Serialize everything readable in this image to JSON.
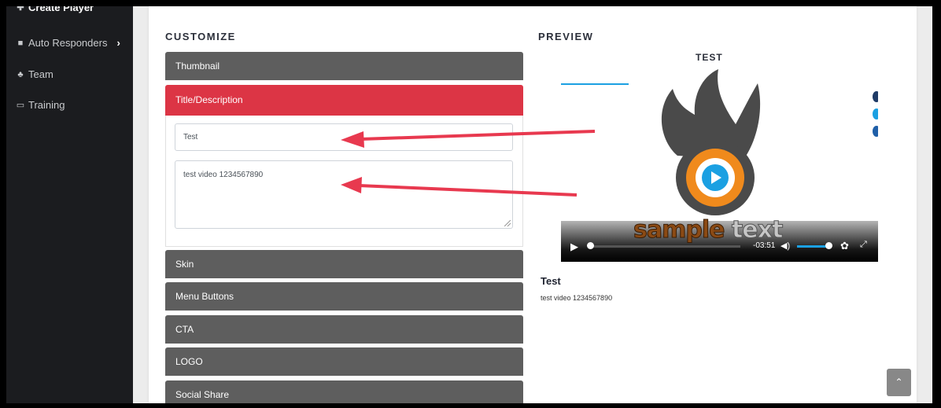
{
  "sidebar": {
    "items": [
      {
        "label": "Create Player",
        "icon": "plus-icon"
      },
      {
        "label": "Auto Responders",
        "icon": "folder-icon"
      },
      {
        "label": "Team",
        "icon": "team-icon"
      },
      {
        "label": "Training",
        "icon": "monitor-icon"
      }
    ]
  },
  "customize": {
    "heading": "CUSTOMIZE",
    "sections": [
      {
        "label": "Thumbnail"
      },
      {
        "label": "Title/Description"
      },
      {
        "label": "Skin"
      },
      {
        "label": "Menu Buttons"
      },
      {
        "label": "CTA"
      },
      {
        "label": "LOGO"
      },
      {
        "label": "Social Share"
      }
    ],
    "title_value": "Test",
    "description_value": "test video 1234567890"
  },
  "preview": {
    "heading": "PREVIEW",
    "video_name": "TEST",
    "overlay_text_1": "sample",
    "overlay_text_2": "text",
    "time_remaining": "-03:51",
    "caption_title": "Test",
    "caption_description": "test video 1234567890"
  },
  "colors": {
    "accent": "#dc3545",
    "accordion": "#5e5e5e",
    "sidebar": "#1b1c1f",
    "play_orange": "#f08a1c",
    "play_blue": "#1ba0e2",
    "annotation_arrow": "#e8394f"
  }
}
